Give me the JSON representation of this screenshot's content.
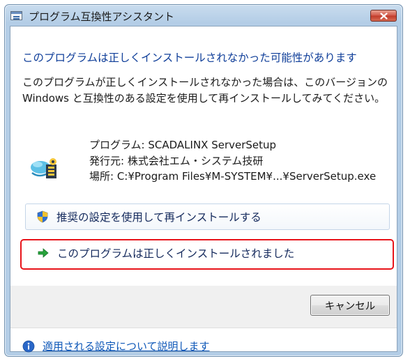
{
  "window": {
    "title": "プログラム互換性アシスタント"
  },
  "heading": "このプログラムは正しくインストールされなかった可能性があります",
  "description": "このプログラムが正しくインストールされなかった場合は、このバージョンの Windows と互換性のある設定を使用して再インストールしてみてください。",
  "program_info": {
    "program": "プログラム: SCADALINX ServerSetup",
    "publisher": "発行元: 株式会社エム・システム技研",
    "location": "場所: C:¥Program Files¥M-SYSTEM¥...¥ServerSetup.exe"
  },
  "options": {
    "reinstall_label": "推奨の設定を使用して再インストールする",
    "installed_ok_label": "このプログラムは正しくインストールされました"
  },
  "buttons": {
    "cancel_label": "キャンセル"
  },
  "footer": {
    "help_link": "適用される設定について説明します"
  },
  "icons": {
    "window_icon": "window-app-icon",
    "close": "close-icon",
    "program": "program-gear-icon",
    "shield": "uac-shield-icon",
    "arrow": "green-arrow-icon",
    "info": "info-icon"
  },
  "colors": {
    "heading": "#0f3e99",
    "highlight_border": "#e8141a",
    "link": "#0d57b8",
    "option_text": "#14295c"
  }
}
